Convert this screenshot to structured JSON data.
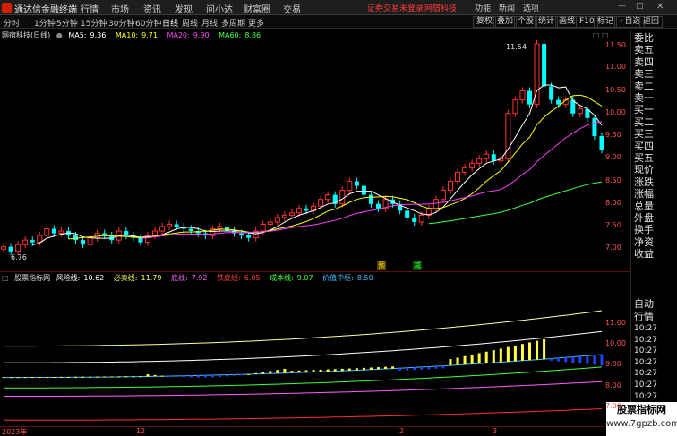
{
  "menubar": {
    "app_title": "通达信金融终端",
    "menus": [
      "行情",
      "市场",
      "资讯",
      "发现",
      "问小达",
      "财富圈",
      "交易"
    ],
    "notice": "证券交易未登录",
    "notice2": "网宿科技",
    "right_items": [
      "功能",
      "新闻",
      "选项"
    ]
  },
  "toolbar": {
    "periods": [
      "分时",
      "1分钟",
      "5分钟",
      "15分钟",
      "30分钟",
      "60分钟",
      "日线",
      "周线",
      "月线",
      "多周期",
      "更多"
    ],
    "active_period": "日线",
    "right_tools": [
      "复权",
      "叠加",
      "个股",
      "统计",
      "画线",
      "F10",
      "标记",
      "+自选",
      "返回"
    ]
  },
  "main_chart": {
    "stock_name": "网宿科技(日线)",
    "ma": [
      {
        "label": "MA5:",
        "value": "9.36",
        "color": "#ffffff"
      },
      {
        "label": "MA10:",
        "value": "9.71",
        "color": "#ffff00"
      },
      {
        "label": "MA20:",
        "value": "9.90",
        "color": "#ff40ff"
      },
      {
        "label": "MA60:",
        "value": "8.86",
        "color": "#40ff40"
      }
    ],
    "high_label": "11.54",
    "low_label": "6.76",
    "price_ticks": [
      "11.50",
      "11.00",
      "10.50",
      "10.00",
      "9.50",
      "9.00",
      "8.50",
      "8.00",
      "7.50",
      "7.00"
    ],
    "markers": [
      {
        "text": "预",
        "color": "#ffd700"
      },
      {
        "text": "减",
        "color": "#40ff40"
      }
    ]
  },
  "indicator": {
    "name": "股票指标网",
    "items": [
      {
        "label": "风险线:",
        "value": "10.62",
        "color": "#ffffff"
      },
      {
        "label": "必卖线:",
        "value": "11.79",
        "color": "#ffff60"
      },
      {
        "label": "底线:",
        "value": "7.92",
        "color": "#ff60ff"
      },
      {
        "label": "铁底线:",
        "value": "6.05",
        "color": "#ff4040"
      },
      {
        "label": "成本线:",
        "value": "9.07",
        "color": "#40ff40"
      },
      {
        "label": "价值中枢:",
        "value": "8.50",
        "color": "#40c0ff"
      }
    ],
    "price_ticks": [
      "11.00",
      "10.00",
      "9.00",
      "8.00",
      "7.00"
    ]
  },
  "bottom_axis": {
    "labels": [
      "2023年",
      "12",
      "2",
      "3"
    ]
  },
  "right_panel": {
    "items": [
      "委比",
      "卖五",
      "卖四",
      "卖三",
      "卖二",
      "卖一",
      "买一",
      "买二",
      "买三",
      "买四",
      "买五",
      "现价",
      "涨跌",
      "涨幅",
      "总量",
      "外盘",
      "换手",
      "净资",
      "收益"
    ],
    "items2": [
      "自动",
      "行情"
    ],
    "times": [
      "10:27",
      "10:27",
      "10:27",
      "10:27",
      "10:27",
      "10:27",
      "10:27",
      "10:27",
      "10:27",
      "10:27"
    ]
  },
  "watermark": {
    "line1": "股票指标网",
    "line2": "www.7gpzb.com"
  }
}
